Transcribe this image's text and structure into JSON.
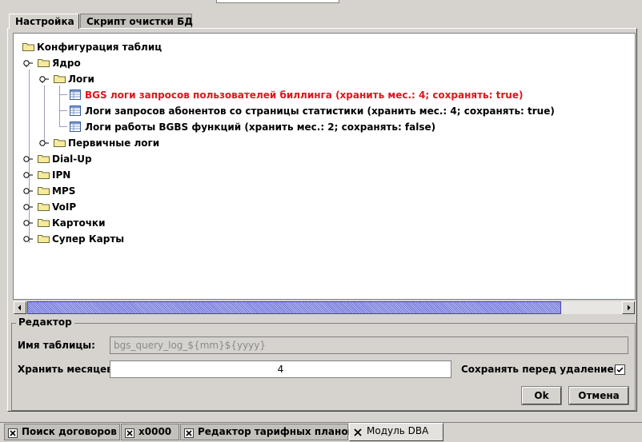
{
  "tabs": [
    {
      "label": "Настройка",
      "active": true
    },
    {
      "label": "Скрипт очистки БД",
      "active": false
    }
  ],
  "tree": {
    "root": "Конфигурация таблиц",
    "core": "Ядро",
    "logs": "Логи",
    "log_items": [
      {
        "label": "BGS логи запросов пользователей биллинга (хранить мес.: 4; сохранять: true)",
        "color": "#e0141e"
      },
      {
        "label": "Логи запросов абонентов со страницы статистики (хранить мес.: 4; сохранять: true)",
        "color": "#000000"
      },
      {
        "label": "Логи работы BGBS функций (хранить мес.: 2; сохранять: false)",
        "color": "#000000"
      }
    ],
    "primary_logs": "Первичные логи",
    "modules": [
      "Dial-Up",
      "IPN",
      "MPS",
      "VoIP",
      "Карточки",
      "Супер Карты"
    ]
  },
  "editor": {
    "title": "Редактор",
    "table_name_label": "Имя таблицы:",
    "table_name_value": "bgs_query_log_${mm}${yyyy}",
    "months_label": "Хранить месяцев:",
    "months_value": "4",
    "save_label": "Сохранять перед удалением:",
    "save_checked": true,
    "ok_label": "Ok",
    "cancel_label": "Отмена"
  },
  "bottom_tabs": [
    {
      "label": "Поиск договоров",
      "active": false
    },
    {
      "label": "x0000",
      "active": false
    },
    {
      "label": "Редактор тарифных планов",
      "active": false
    },
    {
      "label": "Модуль DBA",
      "active": true
    }
  ],
  "colors": {
    "window_bg": "#d6d3ce",
    "selected_item": "#e0141e",
    "scroll_thumb": "#6f72d8",
    "tree_line": "#9a9ac8"
  },
  "icons": {
    "folder": "folder-icon",
    "table": "table-icon",
    "expand": "expand-handle-icon",
    "close": "close-icon",
    "checkmark": "checkmark-icon"
  }
}
